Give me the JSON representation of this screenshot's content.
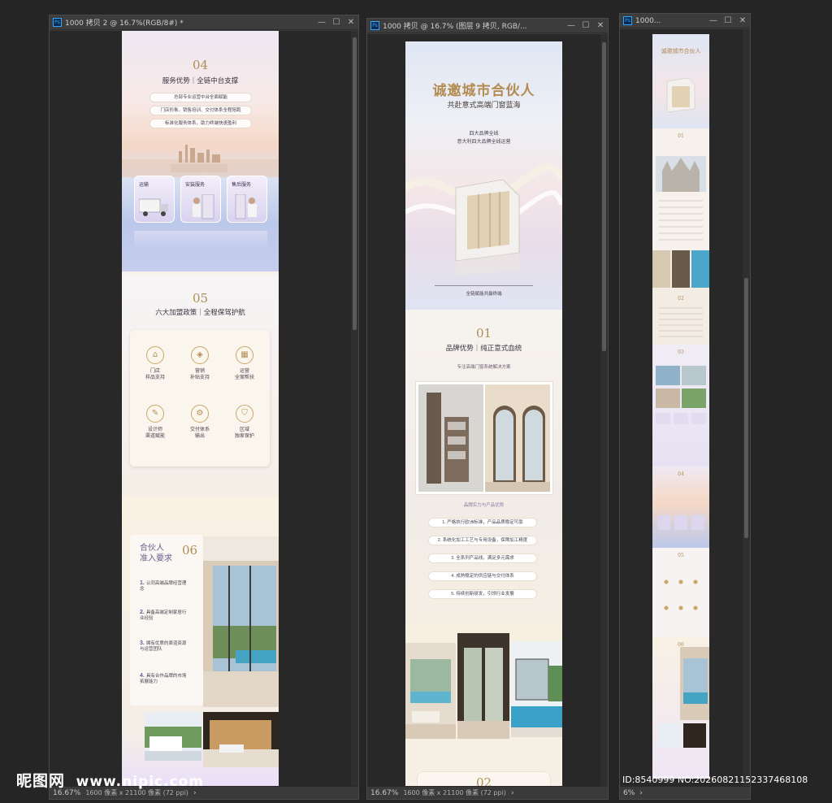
{
  "windows": [
    {
      "title": "1000 拷贝 2 @ 16.7%(RGB/8#) *",
      "zoom": "16.67%",
      "size_info": "1600 像素 x 21100 像素 (72 ppi)"
    },
    {
      "title": "1000 拷贝 @ 16.7% (图层 9 拷贝, RGB/...",
      "zoom": "16.67%",
      "size_info": "1600 像素 x 21100 像素 (72 ppi)"
    },
    {
      "title": "1000...",
      "zoom": "6%",
      "size_info": ""
    }
  ],
  "icon_labels": {
    "app": "Ps",
    "minimize": "—",
    "maximize": "☐",
    "close": "✕",
    "status_arrow": "›"
  },
  "doc1": {
    "s04": {
      "num": "04",
      "heading": "服务优势｜全链中台支撑",
      "pills": [
        "总部专业运营中台全面赋能",
        "门店形象、销售培训、交付体系全程陪跑",
        "标准化服务体系，助力终端快速盈利"
      ],
      "cards": [
        "运输",
        "安装服务",
        "售后服务"
      ]
    },
    "s05": {
      "num": "05",
      "heading": "六大加盟政策｜全程保驾护航",
      "items": [
        "门店\n样品支持",
        "营销\n补贴支持",
        "运营\n全案帮扶",
        "设计师\n渠道赋能",
        "交付体系\n输出",
        "区域\n独家保护"
      ]
    },
    "s06": {
      "num": "06",
      "title_line1": "合伙人",
      "title_line2": "准入要求",
      "reqs": [
        "认同高端品牌经营理念",
        "具备高端定制家居行业经验",
        "拥有优质的渠道资源与运营团队",
        "具有合作品牌的市场拓展能力"
      ]
    }
  },
  "doc2": {
    "hero_title": "诚邀城市合伙人",
    "hero_sub": "共赴意式高端门窗蓝海",
    "hero_line1": "四大品牌全线",
    "hero_line2": "意大利四大品牌全线运营",
    "hero_footer": "全链赋能共赢终端",
    "s01": {
      "num": "01",
      "heading": "品牌优势｜纯正意式血统",
      "sub": "专注高端门窗系统解决方案",
      "caption": "品牌实力与产品优势",
      "points": [
        "1. 严格执行欧洲标准，产品品质稳定可靠",
        "2. 系统化加工工艺与专用设备，保障加工精度",
        "3. 全系列产品线，满足多元需求",
        "4. 成熟稳定的供应链与交付体系",
        "5. 持续创新研发，引领行业发展"
      ]
    },
    "s02_num": "02"
  },
  "doc3": {
    "labels": [
      "01",
      "02",
      "03",
      "04",
      "05",
      "06"
    ]
  },
  "watermark": {
    "brand": "昵图网",
    "url": "www.nipic.com",
    "id": "ID:8540999 NO:20260821152337468108"
  }
}
